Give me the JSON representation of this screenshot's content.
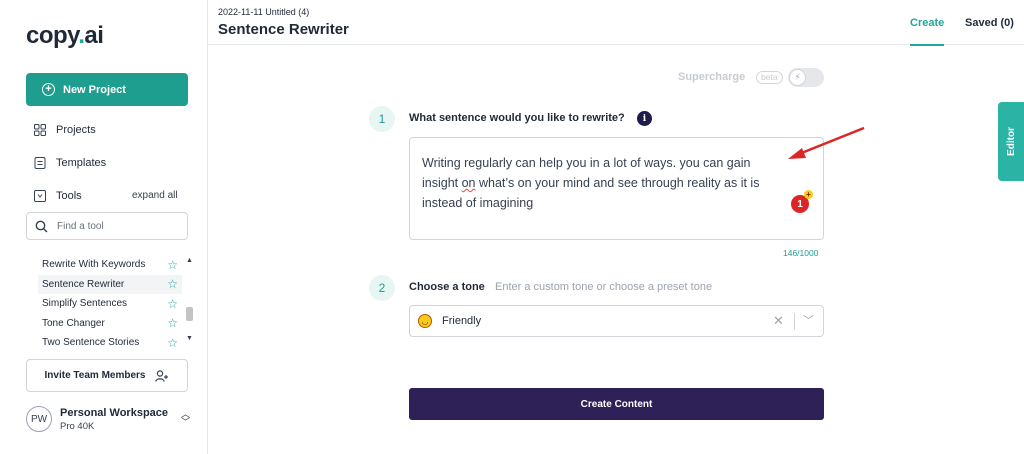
{
  "brand": {
    "logo_left": "copy",
    "logo_dot": ".",
    "logo_right": "ai"
  },
  "sidebar": {
    "new_project": "New Project",
    "nav": [
      {
        "label": "Projects",
        "icon": "grid-icon"
      },
      {
        "label": "Templates",
        "icon": "document-icon"
      },
      {
        "label": "Tools",
        "icon": "tools-icon"
      }
    ],
    "expand_all": "expand all",
    "search_placeholder": "Find a tool",
    "tools": [
      {
        "label": "Rewrite With Keywords"
      },
      {
        "label": "Sentence Rewriter",
        "active": true
      },
      {
        "label": "Simplify Sentences"
      },
      {
        "label": "Tone Changer"
      },
      {
        "label": "Two Sentence Stories"
      }
    ],
    "invite": "Invite Team Members",
    "workspace": {
      "initials": "PW",
      "name": "Personal Workspace",
      "plan": "Pro 40K"
    }
  },
  "header": {
    "breadcrumb": "2022-11-11 Untitled (4)",
    "title": "Sentence Rewriter",
    "tabs": {
      "create": "Create",
      "saved": "Saved (0)"
    }
  },
  "supercharge": {
    "label": "Supercharge",
    "beta": "beta"
  },
  "form": {
    "step1_num": "1",
    "step1_label": "What sentence would you like to rewrite?",
    "info": "i",
    "text_before": "Writing regularly can help you in a lot of ways. you can gain insight ",
    "text_spell": "on",
    "text_after": " what’s on your mind and see through reality as it is instead of imagining",
    "counter": "146/1000",
    "badge": "1",
    "badge_plus": "+",
    "step2_num": "2",
    "step2_label": "Choose a tone",
    "tone_hint": "Enter a custom tone or choose a preset tone",
    "tone_value": "Friendly",
    "create_button": "Create Content"
  },
  "editor_tab": "Editor",
  "colors": {
    "accent": "#1e9e8f",
    "primary_button": "#2d2158",
    "editor_tab": "#2bb3a6"
  }
}
